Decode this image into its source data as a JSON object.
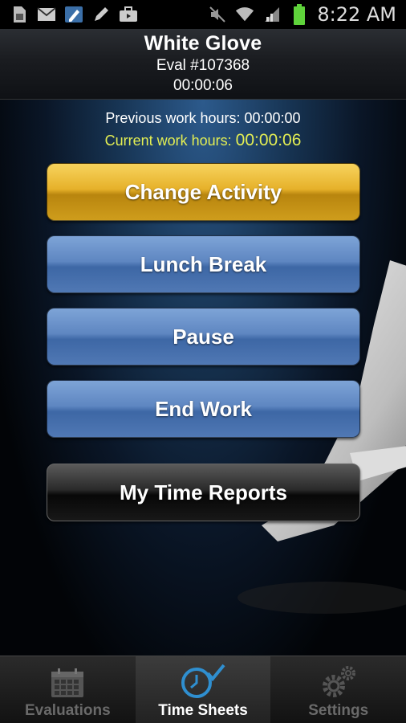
{
  "status_bar": {
    "time": "8:22 AM",
    "icons": [
      "sim-card-icon",
      "mail-icon",
      "pen-app-icon",
      "edit-icon",
      "briefcase-icon",
      "mute-icon",
      "wifi-icon",
      "signal-icon",
      "battery-icon"
    ]
  },
  "header": {
    "title": "White Glove",
    "eval_number": "Eval #107368",
    "elapsed": "00:00:06"
  },
  "hours": {
    "previous_label": "Previous work hours: 00:00:00",
    "current_label": "Current work hours:",
    "current_value": "00:00:06"
  },
  "buttons": {
    "change_activity": "Change Activity",
    "lunch_break": "Lunch Break",
    "pause": "Pause",
    "end_work": "End Work",
    "my_time_reports": "My Time Reports"
  },
  "tabs": [
    {
      "label": "Evaluations",
      "icon": "calendar-icon",
      "active": false
    },
    {
      "label": "Time Sheets",
      "icon": "clock-check-icon",
      "active": true
    },
    {
      "label": "Settings",
      "icon": "gears-icon",
      "active": false
    }
  ],
  "colors": {
    "accent_yellow": "#e3ee53",
    "button_gold": "#e6b12a",
    "button_blue": "#5e86c1"
  }
}
